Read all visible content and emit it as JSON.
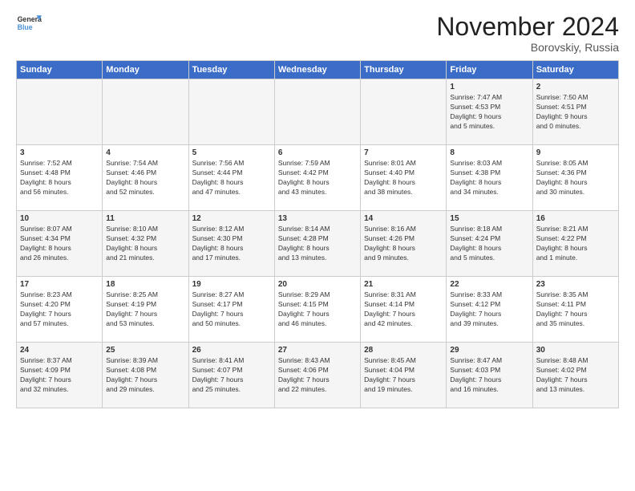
{
  "logo": {
    "line1": "General",
    "line2": "Blue"
  },
  "title": "November 2024",
  "location": "Borovskiy, Russia",
  "days_of_week": [
    "Sunday",
    "Monday",
    "Tuesday",
    "Wednesday",
    "Thursday",
    "Friday",
    "Saturday"
  ],
  "weeks": [
    [
      {
        "day": "",
        "info": ""
      },
      {
        "day": "",
        "info": ""
      },
      {
        "day": "",
        "info": ""
      },
      {
        "day": "",
        "info": ""
      },
      {
        "day": "",
        "info": ""
      },
      {
        "day": "1",
        "info": "Sunrise: 7:47 AM\nSunset: 4:53 PM\nDaylight: 9 hours\nand 5 minutes."
      },
      {
        "day": "2",
        "info": "Sunrise: 7:50 AM\nSunset: 4:51 PM\nDaylight: 9 hours\nand 0 minutes."
      }
    ],
    [
      {
        "day": "3",
        "info": "Sunrise: 7:52 AM\nSunset: 4:48 PM\nDaylight: 8 hours\nand 56 minutes."
      },
      {
        "day": "4",
        "info": "Sunrise: 7:54 AM\nSunset: 4:46 PM\nDaylight: 8 hours\nand 52 minutes."
      },
      {
        "day": "5",
        "info": "Sunrise: 7:56 AM\nSunset: 4:44 PM\nDaylight: 8 hours\nand 47 minutes."
      },
      {
        "day": "6",
        "info": "Sunrise: 7:59 AM\nSunset: 4:42 PM\nDaylight: 8 hours\nand 43 minutes."
      },
      {
        "day": "7",
        "info": "Sunrise: 8:01 AM\nSunset: 4:40 PM\nDaylight: 8 hours\nand 38 minutes."
      },
      {
        "day": "8",
        "info": "Sunrise: 8:03 AM\nSunset: 4:38 PM\nDaylight: 8 hours\nand 34 minutes."
      },
      {
        "day": "9",
        "info": "Sunrise: 8:05 AM\nSunset: 4:36 PM\nDaylight: 8 hours\nand 30 minutes."
      }
    ],
    [
      {
        "day": "10",
        "info": "Sunrise: 8:07 AM\nSunset: 4:34 PM\nDaylight: 8 hours\nand 26 minutes."
      },
      {
        "day": "11",
        "info": "Sunrise: 8:10 AM\nSunset: 4:32 PM\nDaylight: 8 hours\nand 21 minutes."
      },
      {
        "day": "12",
        "info": "Sunrise: 8:12 AM\nSunset: 4:30 PM\nDaylight: 8 hours\nand 17 minutes."
      },
      {
        "day": "13",
        "info": "Sunrise: 8:14 AM\nSunset: 4:28 PM\nDaylight: 8 hours\nand 13 minutes."
      },
      {
        "day": "14",
        "info": "Sunrise: 8:16 AM\nSunset: 4:26 PM\nDaylight: 8 hours\nand 9 minutes."
      },
      {
        "day": "15",
        "info": "Sunrise: 8:18 AM\nSunset: 4:24 PM\nDaylight: 8 hours\nand 5 minutes."
      },
      {
        "day": "16",
        "info": "Sunrise: 8:21 AM\nSunset: 4:22 PM\nDaylight: 8 hours\nand 1 minute."
      }
    ],
    [
      {
        "day": "17",
        "info": "Sunrise: 8:23 AM\nSunset: 4:20 PM\nDaylight: 7 hours\nand 57 minutes."
      },
      {
        "day": "18",
        "info": "Sunrise: 8:25 AM\nSunset: 4:19 PM\nDaylight: 7 hours\nand 53 minutes."
      },
      {
        "day": "19",
        "info": "Sunrise: 8:27 AM\nSunset: 4:17 PM\nDaylight: 7 hours\nand 50 minutes."
      },
      {
        "day": "20",
        "info": "Sunrise: 8:29 AM\nSunset: 4:15 PM\nDaylight: 7 hours\nand 46 minutes."
      },
      {
        "day": "21",
        "info": "Sunrise: 8:31 AM\nSunset: 4:14 PM\nDaylight: 7 hours\nand 42 minutes."
      },
      {
        "day": "22",
        "info": "Sunrise: 8:33 AM\nSunset: 4:12 PM\nDaylight: 7 hours\nand 39 minutes."
      },
      {
        "day": "23",
        "info": "Sunrise: 8:35 AM\nSunset: 4:11 PM\nDaylight: 7 hours\nand 35 minutes."
      }
    ],
    [
      {
        "day": "24",
        "info": "Sunrise: 8:37 AM\nSunset: 4:09 PM\nDaylight: 7 hours\nand 32 minutes."
      },
      {
        "day": "25",
        "info": "Sunrise: 8:39 AM\nSunset: 4:08 PM\nDaylight: 7 hours\nand 29 minutes."
      },
      {
        "day": "26",
        "info": "Sunrise: 8:41 AM\nSunset: 4:07 PM\nDaylight: 7 hours\nand 25 minutes."
      },
      {
        "day": "27",
        "info": "Sunrise: 8:43 AM\nSunset: 4:06 PM\nDaylight: 7 hours\nand 22 minutes."
      },
      {
        "day": "28",
        "info": "Sunrise: 8:45 AM\nSunset: 4:04 PM\nDaylight: 7 hours\nand 19 minutes."
      },
      {
        "day": "29",
        "info": "Sunrise: 8:47 AM\nSunset: 4:03 PM\nDaylight: 7 hours\nand 16 minutes."
      },
      {
        "day": "30",
        "info": "Sunrise: 8:48 AM\nSunset: 4:02 PM\nDaylight: 7 hours\nand 13 minutes."
      }
    ]
  ]
}
